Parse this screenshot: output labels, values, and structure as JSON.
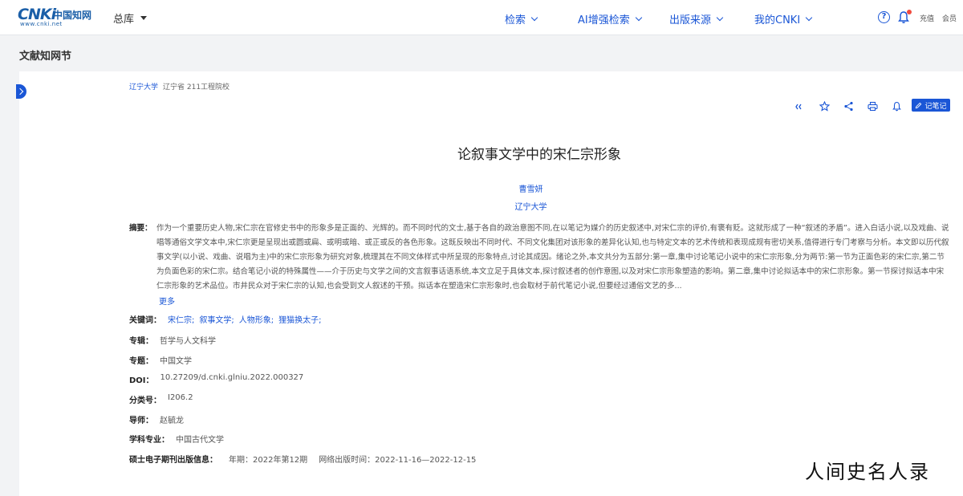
{
  "header": {
    "logo_text": "CNKi",
    "logo_cn": "中国知网",
    "logo_sub": "www.cnki.net",
    "library_label": "总库",
    "nav": [
      {
        "label": "检索"
      },
      {
        "label": "AI增强检索"
      },
      {
        "label": "出版来源"
      },
      {
        "label": "我的CNKI"
      }
    ],
    "help_glyph": "?",
    "recharge_label": "充值",
    "member_label": "会员"
  },
  "section_title": "文献知网节",
  "org_tags": {
    "org": "辽宁大学",
    "tags": "辽宁省 211工程院校"
  },
  "toolbar": {
    "note_label": "记笔记",
    "icons": [
      "quote-icon",
      "star-icon",
      "share-icon",
      "print-icon",
      "bell-icon"
    ]
  },
  "paper": {
    "title": "论叙事文学中的宋仁宗形象",
    "author": "曹雪妍",
    "affiliation": "辽宁大学",
    "abstract_label": "摘要：",
    "abstract_text": "作为一个重要历史人物,宋仁宗在官修史书中的形象多是正面的、光辉的。而不同时代的文士,基于各自的政治意图不同,在以笔记为媒介的历史叙述中,对宋仁宗的评价,有褒有贬。这就形成了一种“叙述的矛盾”。进入白话小说,以及戏曲、说唱等通俗文学文本中,宋仁宗更是呈现出或圆或扁、或明或暗、或正或反的各色形象。这既反映出不同时代、不同文化集团对该形象的差异化认知,也与特定文本的艺术传统和表现成规有密切关系,值得进行专门考察与分析。本文即以历代叙事文学(以小说、戏曲、说唱为主)中的宋仁宗形象为研究对象,梳理其在不同文体样式中所呈现的形象特点,讨论其成因。绪论之外,本文共分为五部分:第一章,集中讨论笔记小说中的宋仁宗形象,分为两节:第一节为正面色彩的宋仁宗,第二节为负面色彩的宋仁宗。结合笔记小说的特殊属性——介于历史与文学之间的文言叙事话语系统,本文立足于具体文本,探讨叙述者的创作意图,以及对宋仁宗形象塑造的影响。第二章,集中讨论拟话本中的宋仁宗形象。第一节探讨拟话本中宋仁宗形象的艺术品位。市井民众对于宋仁宗的认知,也会受到文人叙述的干预。拟话本在塑造宋仁宗形象时,也会取材于前代笔记小说,但要经过通俗文艺的多...",
    "more_label": "更多",
    "keywords_label": "关键词：",
    "keywords": [
      "宋仁宗;",
      "叙事文学;",
      "人物形象;",
      "狸猫换太子;"
    ],
    "series_label": "专辑：",
    "series": "哲学与人文科学",
    "topic_label": "专题：",
    "topic": "中国文学",
    "doi_label": "DOI：",
    "doi": "10.27209/d.cnki.glniu.2022.000327",
    "class_label": "分类号：",
    "class_no": "I206.2",
    "advisor_label": "导师：",
    "advisor": "赵毓龙",
    "major_label": "学科专业：",
    "major": "中国古代文学",
    "pub_label": "硕士电子期刊出版信息：",
    "pub_year": "年期：2022年第12期",
    "pub_online": "网络出版时间：2022-11-16—2022-12-15"
  },
  "watermark": "人间史名人录"
}
